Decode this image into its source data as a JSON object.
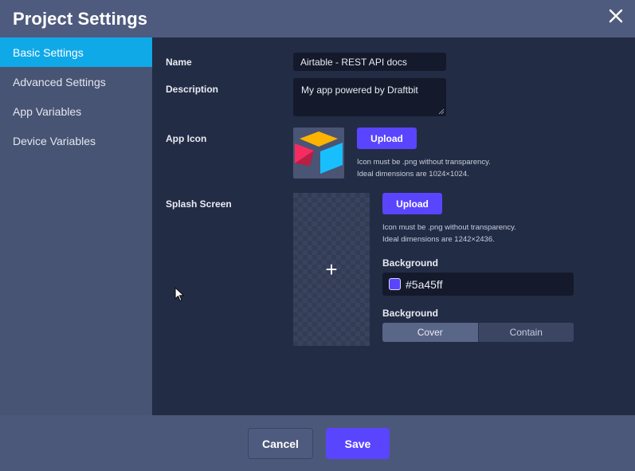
{
  "header": {
    "title": "Project Settings",
    "close_icon": "close-icon"
  },
  "sidebar": {
    "items": [
      {
        "label": "Basic Settings",
        "active": true
      },
      {
        "label": "Advanced Settings",
        "active": false
      },
      {
        "label": "App Variables",
        "active": false
      },
      {
        "label": "Device Variables",
        "active": false
      }
    ]
  },
  "form": {
    "name": {
      "label": "Name",
      "value": "Airtable - REST API docs"
    },
    "description": {
      "label": "Description",
      "value": "My app powered by Draftbit"
    },
    "app_icon": {
      "label": "App Icon",
      "upload_label": "Upload",
      "hint_line1": "Icon must be .png without transparency.",
      "hint_line2": "Ideal dimensions are 1024×1024."
    },
    "splash": {
      "label": "Splash Screen",
      "upload_label": "Upload",
      "hint_line1": "Icon must be .png without transparency.",
      "hint_line2": "Ideal dimensions are 1242×2436.",
      "add_symbol": "+",
      "background_color_label": "Background",
      "background_color_value": "#5a45ff",
      "background_mode_label": "Background",
      "modes": [
        {
          "label": "Cover",
          "selected": true
        },
        {
          "label": "Contain",
          "selected": false
        }
      ]
    }
  },
  "footer": {
    "cancel_label": "Cancel",
    "save_label": "Save"
  },
  "colors": {
    "accent": "#5a45ff",
    "active_tab": "#10a9e8",
    "content_bg": "#232c45",
    "sidebar_bg": "#485473"
  }
}
